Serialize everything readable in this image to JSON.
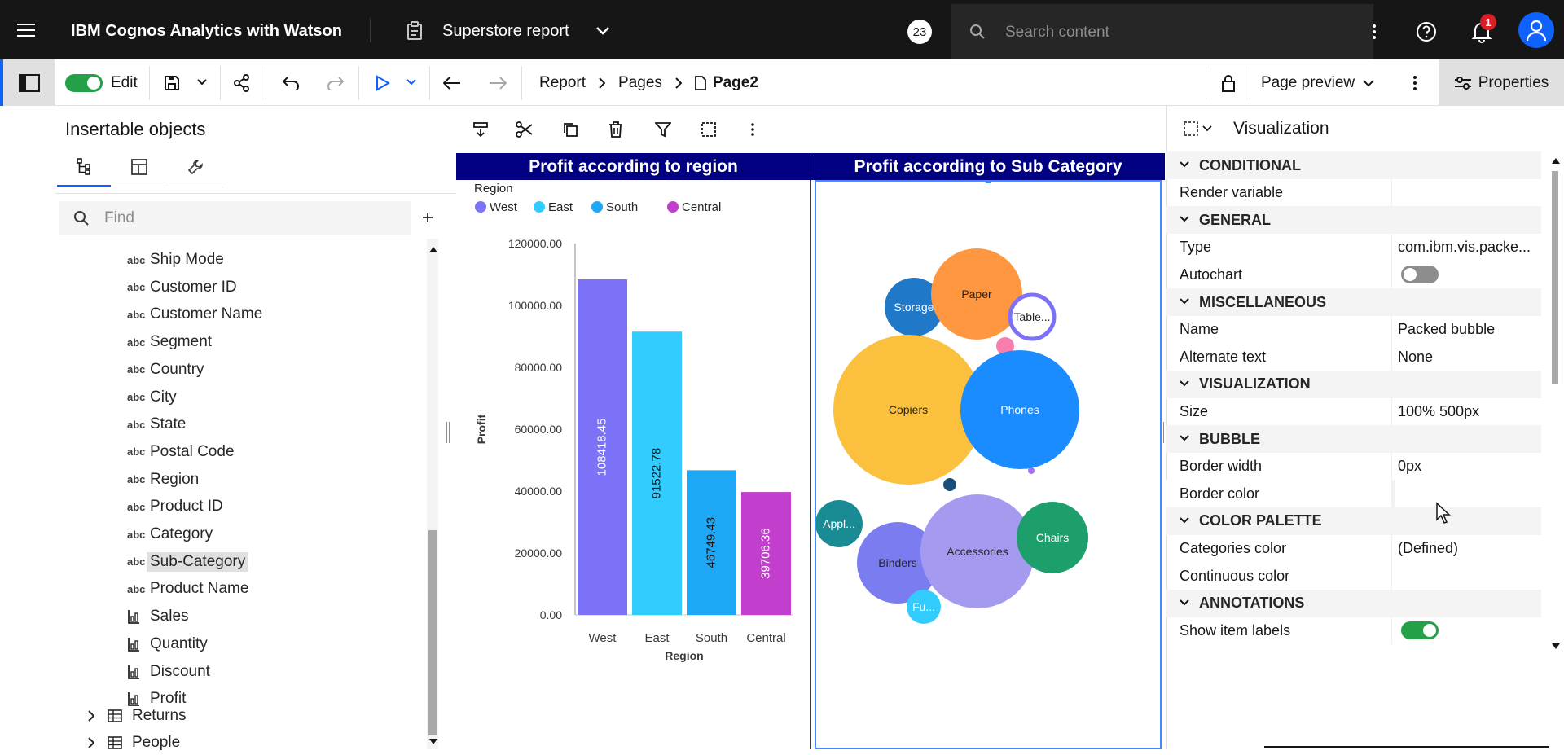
{
  "topbar": {
    "app_name": "IBM Cognos Analytics with Watson",
    "report_name": "Superstore report",
    "presence_badge": "23",
    "search_placeholder": "Search content",
    "notification_count": "1"
  },
  "toolbar": {
    "edit_label": "Edit",
    "breadcrumb": [
      "Report",
      "Pages",
      "Page2"
    ],
    "page_preview_label": "Page preview",
    "properties_label": "Properties"
  },
  "left_panel": {
    "title": "Insertable objects",
    "find_placeholder": "Find",
    "items": [
      {
        "label": "Ship Mode",
        "kind": "abc"
      },
      {
        "label": "Customer ID",
        "kind": "abc"
      },
      {
        "label": "Customer Name",
        "kind": "abc"
      },
      {
        "label": "Segment",
        "kind": "abc"
      },
      {
        "label": "Country",
        "kind": "abc"
      },
      {
        "label": "City",
        "kind": "abc"
      },
      {
        "label": "State",
        "kind": "abc"
      },
      {
        "label": "Postal Code",
        "kind": "abc"
      },
      {
        "label": "Region",
        "kind": "abc"
      },
      {
        "label": "Product ID",
        "kind": "abc"
      },
      {
        "label": "Category",
        "kind": "abc"
      },
      {
        "label": "Sub-Category",
        "kind": "abc",
        "selected": true
      },
      {
        "label": "Product Name",
        "kind": "abc"
      },
      {
        "label": "Sales",
        "kind": "measure"
      },
      {
        "label": "Quantity",
        "kind": "measure"
      },
      {
        "label": "Discount",
        "kind": "measure"
      },
      {
        "label": "Profit",
        "kind": "measure"
      }
    ],
    "tables": [
      "Returns",
      "People"
    ]
  },
  "charts": {
    "bar_title": "Profit according to region",
    "bubble_title": "Profit according to Sub Category"
  },
  "chart_data": [
    {
      "type": "bar",
      "title": "Profit according to region",
      "legend_title": "Region",
      "legend_position": "top-left",
      "categories": [
        "West",
        "East",
        "South",
        "Central"
      ],
      "values": [
        108418.45,
        91522.78,
        46749.43,
        39706.36
      ],
      "value_labels": [
        "108418.45",
        "91522.78",
        "46749.43",
        "39706.36"
      ],
      "colors": [
        "#7b72f7",
        "#33ccff",
        "#1ea7f5",
        "#c13fcc"
      ],
      "xlabel": "Region",
      "ylabel": "Profit",
      "ylim": [
        0,
        120000
      ],
      "yticks": [
        "0.00",
        "20000.00",
        "40000.00",
        "60000.00",
        "80000.00",
        "100000.00",
        "120000.00"
      ]
    },
    {
      "type": "bubble",
      "title": "Profit according to Sub Category",
      "labels": [
        "Storage",
        "Paper",
        "Table...",
        "Copiers",
        "Phones",
        "Appl...",
        "Binders",
        "Accessories",
        "Chairs",
        "Fu..."
      ],
      "colors": {
        "Storage": "#1f78c8",
        "Paper": "#ff9640",
        "Copiers": "#fbc03d",
        "Phones": "#1a8cff",
        "Appl...": "#198b94",
        "Binders": "#7b7cf0",
        "Accessories": "#a49bf0",
        "Chairs": "#1c9f6b",
        "Fu...": "#33ccff"
      }
    }
  ],
  "properties": {
    "header": "Visualization",
    "rows": [
      {
        "type": "section",
        "label": "CONDITIONAL"
      },
      {
        "type": "row",
        "label": "Render variable",
        "value": ""
      },
      {
        "type": "section",
        "label": "GENERAL"
      },
      {
        "type": "row",
        "label": "Type",
        "value": "com.ibm.vis.packe..."
      },
      {
        "type": "toggle",
        "label": "Autochart",
        "value": "off"
      },
      {
        "type": "section",
        "label": "MISCELLANEOUS"
      },
      {
        "type": "row",
        "label": "Name",
        "value": "Packed bubble"
      },
      {
        "type": "row",
        "label": "Alternate text",
        "value": "None"
      },
      {
        "type": "section",
        "label": "VISUALIZATION"
      },
      {
        "type": "row",
        "label": "Size",
        "value": "100% 500px"
      },
      {
        "type": "section",
        "label": "BUBBLE"
      },
      {
        "type": "row",
        "label": "Border width",
        "value": "0px"
      },
      {
        "type": "row",
        "label": "Border color",
        "value": ""
      },
      {
        "type": "section",
        "label": "COLOR PALETTE"
      },
      {
        "type": "row",
        "label": "Categories color",
        "value": "(Defined)"
      },
      {
        "type": "row",
        "label": "Continuous color",
        "value": ""
      },
      {
        "type": "section",
        "label": "ANNOTATIONS"
      },
      {
        "type": "toggle",
        "label": "Show item labels",
        "value": "on"
      }
    ]
  },
  "colors": {
    "accent": "#0f62fe",
    "toggle_on": "#24a148",
    "bar_title_bg": "#000080"
  }
}
